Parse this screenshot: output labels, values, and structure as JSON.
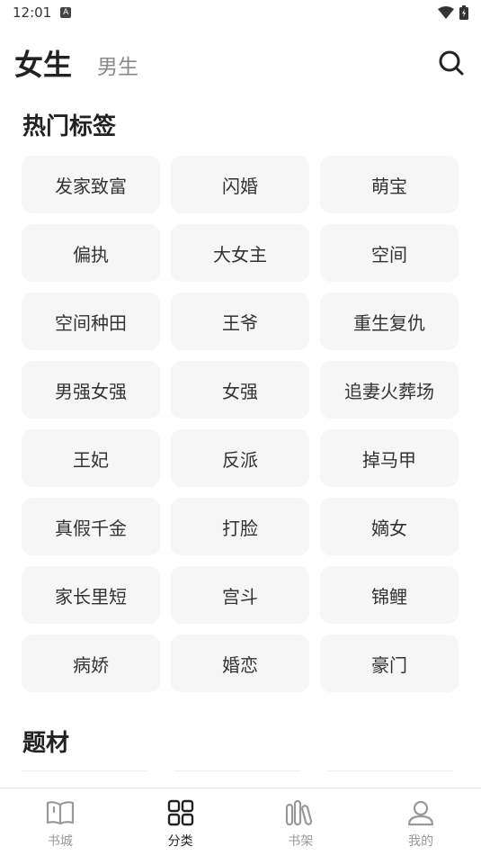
{
  "status_bar": {
    "time": "12:01",
    "notification_glyph": "A"
  },
  "header": {
    "active_tab": "女生",
    "inactive_tab": "男生"
  },
  "hot_tags": {
    "title": "热门标签",
    "items": [
      "发家致富",
      "闪婚",
      "萌宝",
      "偏执",
      "大女主",
      "空间",
      "空间种田",
      "王爷",
      "重生复仇",
      "男强女强",
      "女强",
      "追妻火葬场",
      "王妃",
      "反派",
      "掉马甲",
      "真假千金",
      "打脸",
      "嫡女",
      "家长里短",
      "宫斗",
      "锦鲤",
      "病娇",
      "婚恋",
      "豪门"
    ]
  },
  "subjects": {
    "title": "题材"
  },
  "bottom_nav": {
    "items": [
      {
        "label": "书城",
        "icon": "book-open-icon",
        "active": false
      },
      {
        "label": "分类",
        "icon": "grid-icon",
        "active": true
      },
      {
        "label": "书架",
        "icon": "bookshelf-icon",
        "active": false
      },
      {
        "label": "我的",
        "icon": "person-icon",
        "active": false
      }
    ]
  },
  "colors": {
    "text": "#222222",
    "muted": "#999999",
    "tag_bg": "#f6f6f6"
  }
}
